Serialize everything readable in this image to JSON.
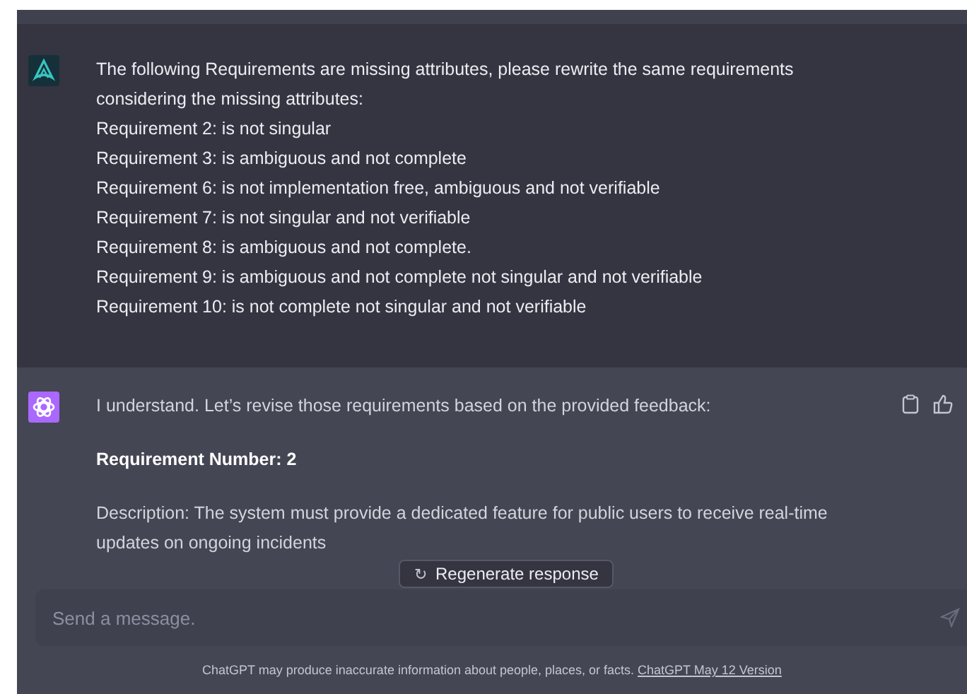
{
  "conversation": [
    {
      "kind": "user",
      "paragraphs": [
        {
          "kind": "text",
          "text": "The following Requirements are missing attributes, please rewrite the same requirements considering the missing attributes:"
        },
        {
          "kind": "text",
          "text": "Requirement 2: is not singular"
        },
        {
          "kind": "text",
          "text": "Requirement 3: is ambiguous and not complete"
        },
        {
          "kind": "text",
          "text": "Requirement 6: is not implementation free, ambiguous and not verifiable"
        },
        {
          "kind": "text",
          "text": "Requirement 7: is not singular and not verifiable"
        },
        {
          "kind": "text",
          "text": "Requirement 8: is ambiguous and not complete."
        },
        {
          "kind": "text",
          "text": "Requirement 9: is ambiguous and not complete not singular and not verifiable"
        },
        {
          "kind": "text",
          "text": "Requirement 10: is not complete not singular and not verifiable"
        }
      ]
    },
    {
      "kind": "assistant",
      "paragraphs": [
        {
          "kind": "text",
          "text": "I understand. Let’s revise those requirements based on the provided feedback:"
        },
        {
          "kind": "heading",
          "text": "Requirement Number: 2"
        },
        {
          "kind": "text",
          "text": "Description: The system must provide a dedicated feature for public users to receive real-time updates on ongoing incidents"
        }
      ]
    }
  ],
  "regenerate_button": {
    "icon": "↻",
    "label": "Regenerate response"
  },
  "composer": {
    "placeholder": "Send a message."
  },
  "footer": {
    "text": "ChatGPT may produce inaccurate information about people, places, or facts.",
    "link": "ChatGPT May 12 Version"
  }
}
